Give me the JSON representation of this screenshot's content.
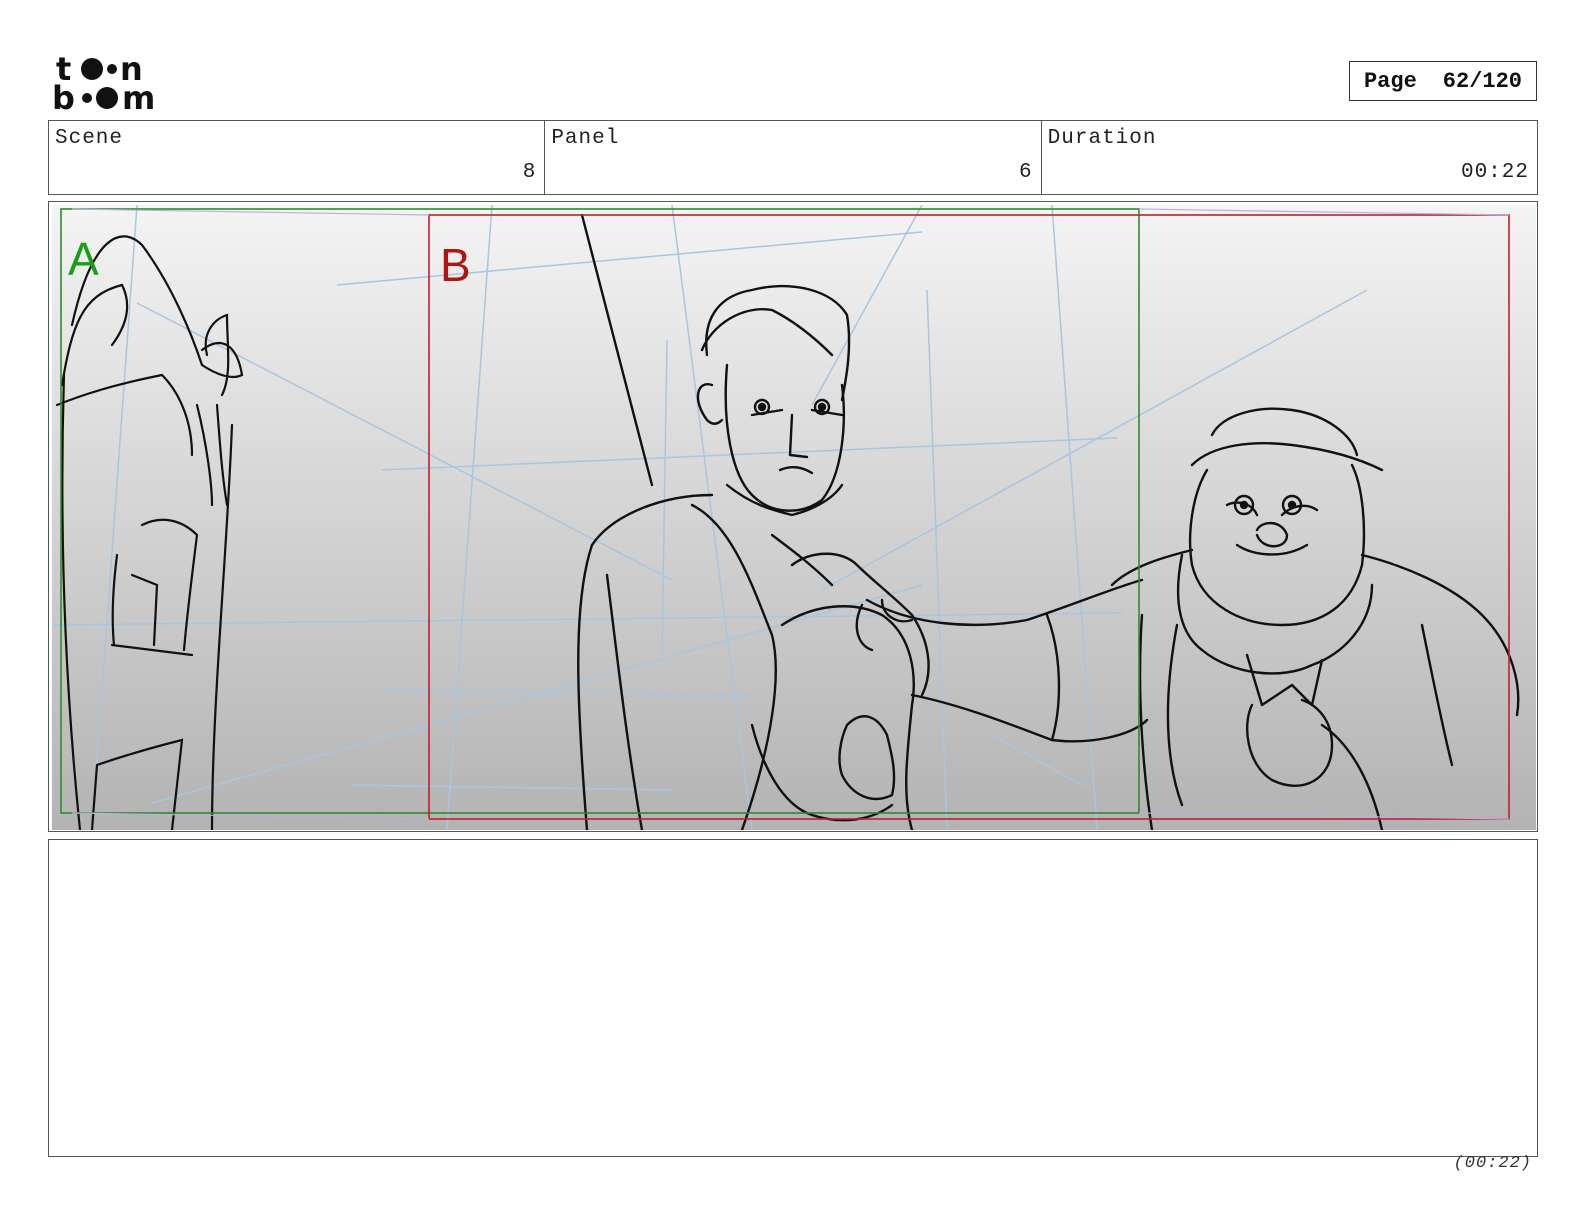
{
  "logo": {
    "line1": "toon",
    "line2": "boom"
  },
  "page": {
    "label": "Page",
    "number": "62/120"
  },
  "info": {
    "scene_label": "Scene",
    "scene_value": "8",
    "panel_label": "Panel",
    "panel_value": "6",
    "duration_label": "Duration",
    "duration_value": "00:22"
  },
  "frames": {
    "a_label": "A",
    "a_color": "#1a9e1a",
    "b_label": "B",
    "b_color": "#b01515"
  },
  "footer": {
    "duration": "(00:22)"
  }
}
